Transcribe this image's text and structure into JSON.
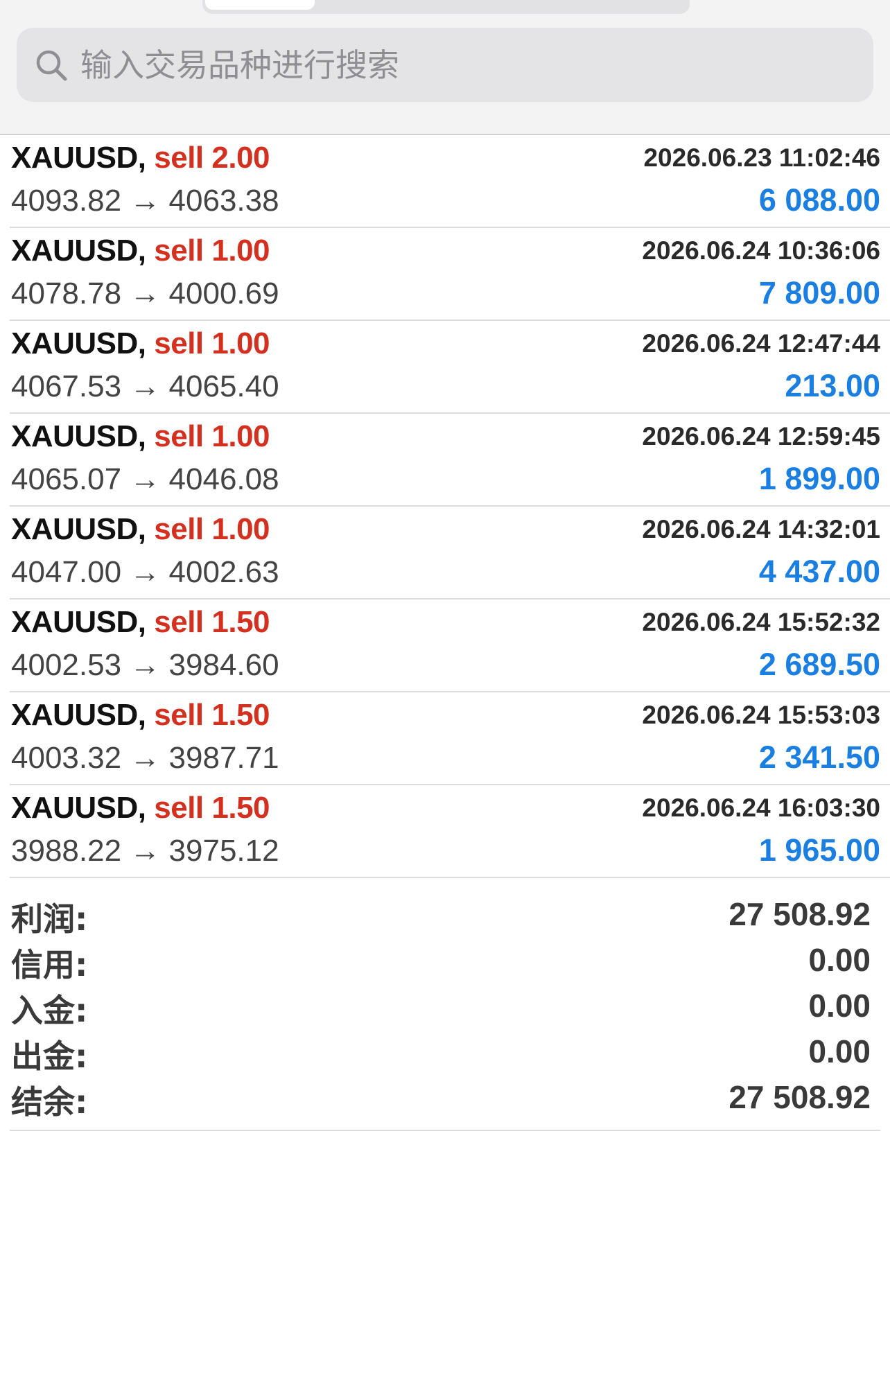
{
  "search": {
    "placeholder": "输入交易品种进行搜索"
  },
  "arrow": "→",
  "icons": {
    "search": "search-icon"
  },
  "colors": {
    "sell": "#d3301f",
    "profit": "#1a7fe0"
  },
  "trades": [
    {
      "symbol": "XAUUSD,",
      "side_volume": "sell 2.00",
      "time": "2026.06.23 11:02:46",
      "open_price": "4093.82",
      "close_price": "4063.38",
      "profit": "6 088.00"
    },
    {
      "symbol": "XAUUSD,",
      "side_volume": "sell 1.00",
      "time": "2026.06.24 10:36:06",
      "open_price": "4078.78",
      "close_price": "4000.69",
      "profit": "7 809.00"
    },
    {
      "symbol": "XAUUSD,",
      "side_volume": "sell 1.00",
      "time": "2026.06.24 12:47:44",
      "open_price": "4067.53",
      "close_price": "4065.40",
      "profit": "213.00"
    },
    {
      "symbol": "XAUUSD,",
      "side_volume": "sell 1.00",
      "time": "2026.06.24 12:59:45",
      "open_price": "4065.07",
      "close_price": "4046.08",
      "profit": "1 899.00"
    },
    {
      "symbol": "XAUUSD,",
      "side_volume": "sell 1.00",
      "time": "2026.06.24 14:32:01",
      "open_price": "4047.00",
      "close_price": "4002.63",
      "profit": "4 437.00"
    },
    {
      "symbol": "XAUUSD,",
      "side_volume": "sell 1.50",
      "time": "2026.06.24 15:52:32",
      "open_price": "4002.53",
      "close_price": "3984.60",
      "profit": "2 689.50"
    },
    {
      "symbol": "XAUUSD,",
      "side_volume": "sell 1.50",
      "time": "2026.06.24 15:53:03",
      "open_price": "4003.32",
      "close_price": "3987.71",
      "profit": "2 341.50"
    },
    {
      "symbol": "XAUUSD,",
      "side_volume": "sell 1.50",
      "time": "2026.06.24 16:03:30",
      "open_price": "3988.22",
      "close_price": "3975.12",
      "profit": "1 965.00"
    }
  ],
  "summary": {
    "profit_label": "利润:",
    "profit_value": "27 508.92",
    "credit_label": "信用:",
    "credit_value": "0.00",
    "deposit_label": "入金:",
    "deposit_value": "0.00",
    "withdrawal_label": "出金:",
    "withdrawal_value": "0.00",
    "balance_label": "结余:",
    "balance_value": "27 508.92"
  }
}
